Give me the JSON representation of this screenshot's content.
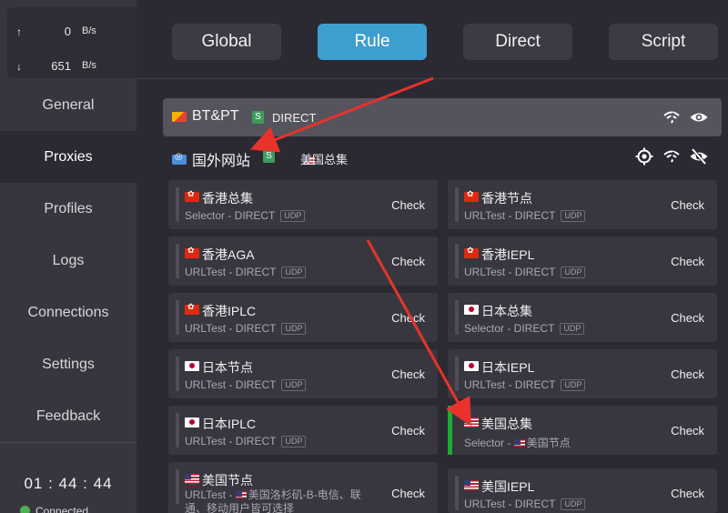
{
  "traffic": {
    "up_arrow": "↑",
    "up_value": "0",
    "up_unit": "B/s",
    "down_arrow": "↓",
    "down_value": "651",
    "down_unit": "B/s"
  },
  "sidebar": {
    "items": [
      {
        "label": "General"
      },
      {
        "label": "Proxies"
      },
      {
        "label": "Profiles"
      },
      {
        "label": "Logs"
      },
      {
        "label": "Connections"
      },
      {
        "label": "Settings"
      },
      {
        "label": "Feedback"
      }
    ],
    "timer": "01 : 44 : 44",
    "status": "Connected"
  },
  "modes": {
    "global": "Global",
    "rule": "Rule",
    "direct": "Direct",
    "script": "Script"
  },
  "groups": {
    "btpt": {
      "name": "BT&PT",
      "badge": "S",
      "selected": "DIRECT"
    },
    "foreign": {
      "name": "国外网站",
      "badge": "S",
      "selected": "美国总集"
    }
  },
  "proxies": [
    {
      "name": "香港总集",
      "sub": "Selector - DIRECT",
      "udp": "UDP",
      "check": "Check"
    },
    {
      "name": "香港节点",
      "sub": "URLTest - DIRECT",
      "udp": "UDP",
      "check": "Check"
    },
    {
      "name": "香港AGA",
      "sub": "URLTest - DIRECT",
      "udp": "UDP",
      "check": "Check"
    },
    {
      "name": "香港IEPL",
      "sub": "URLTest - DIRECT",
      "udp": "UDP",
      "check": "Check"
    },
    {
      "name": "香港IPLC",
      "sub": "URLTest - DIRECT",
      "udp": "UDP",
      "check": "Check"
    },
    {
      "name": "日本总集",
      "sub": "Selector - DIRECT",
      "udp": "UDP",
      "check": "Check"
    },
    {
      "name": "日本节点",
      "sub": "URLTest - DIRECT",
      "udp": "UDP",
      "check": "Check"
    },
    {
      "name": "日本IEPL",
      "sub": "URLTest - DIRECT",
      "udp": "UDP",
      "check": "Check"
    },
    {
      "name": "日本IPLC",
      "sub": "URLTest - DIRECT",
      "udp": "UDP",
      "check": "Check"
    },
    {
      "name": "美国总集",
      "sub": "Selector - ",
      "sub_tail": "美国节点",
      "check": "Check"
    },
    {
      "name": "美国节点",
      "sub": "URLTest - ",
      "sub_tail": "美国洛杉矶-B-电信、联通、移动用户皆可选择",
      "check": "Check"
    },
    {
      "name": "美国IEPL",
      "sub": "URLTest - DIRECT",
      "udp": "UDP",
      "check": "Check"
    }
  ],
  "colors": {
    "accent": "#3d9fd0",
    "selected_bar": "#1bad2e",
    "annotation_arrow": "#e8322b"
  }
}
